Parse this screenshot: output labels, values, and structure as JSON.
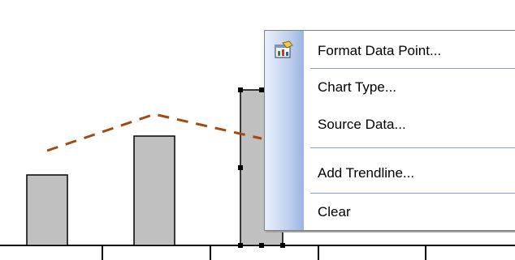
{
  "chart": {
    "type": "bar-with-line",
    "bar_values": [
      2.9,
      4.5,
      6.4
    ],
    "line_values": [
      3.9,
      5.4,
      4.4
    ],
    "selected_bar_index": 2,
    "colors": {
      "bar_fill": "#c0c0c0",
      "bar_stroke": "#000000",
      "line": "#a24a12",
      "axis": "#000000"
    }
  },
  "context_menu": {
    "items": [
      {
        "label": "Format Data Point...",
        "icon": "format-data-point-icon"
      },
      {
        "label": "Chart Type..."
      },
      {
        "label": "Source Data..."
      },
      {
        "label": "Add Trendline..."
      },
      {
        "label": "Clear"
      }
    ]
  }
}
